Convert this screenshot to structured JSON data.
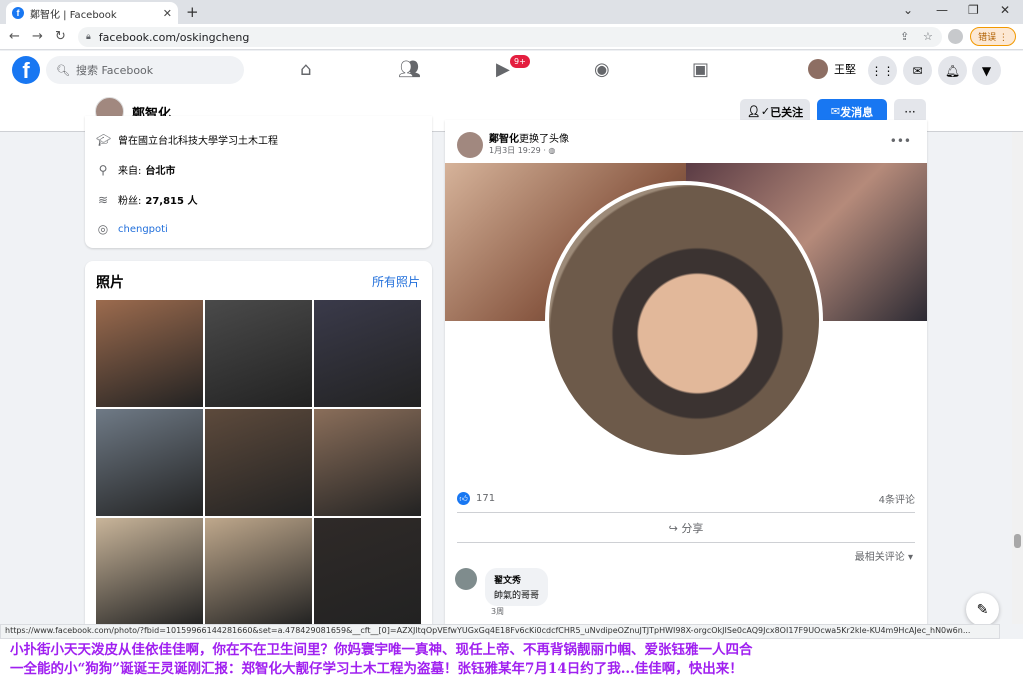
{
  "browser": {
    "tab_title": "鄭智化 | Facebook",
    "tab_close": "✕",
    "new_tab": "+",
    "url": "facebook.com/oskingcheng",
    "error_button": "错误 ⋮",
    "status_url": "https://www.facebook.com/photo/?fbid=10159966144281660&set=a.478429081659&__cft__[0]=AZXJltqOpVEfwYUGxGq4E18Fv6cKi0cdcfCHR5_uNvdipeOZnuJTJTpHWI98X-orgcOkJISe0cAQ9Jcx8OI17F9UOcwa5Kr2kle-KU4m9HcAJec_hN0w6n..."
  },
  "fb": {
    "search_placeholder": "搜索 Facebook",
    "badge": "9+",
    "me_name": "王堅"
  },
  "profile": {
    "name": "鄭智化",
    "follow_label": "已关注",
    "message_label": "发消息",
    "more_label": "···"
  },
  "intro": {
    "education": "曾在國立台北科技大學学习土木工程",
    "from_label": "来自:",
    "from_value": "台北市",
    "followers_label": "粉丝:",
    "followers_value": "27,815 人",
    "instagram": "chengpoti"
  },
  "photos": {
    "title": "照片",
    "all_link": "所有照片",
    "colors": [
      "#9c6b4e",
      "#4a4a4a",
      "#3a3a4a",
      "#6f7a86",
      "#5d4a3c",
      "#8a6e5a",
      "#c9b59a",
      "#bfa88c",
      "#2f2a28"
    ]
  },
  "post": {
    "author": "鄭智化",
    "action": "更换了头像",
    "date": "1月3日 19:29",
    "privacy": "· ◍",
    "reactions": "171",
    "comments_count": "4条评论",
    "share_label": "分享",
    "sort_label": "最相关评论 ▾",
    "comment": {
      "author": "翟文秀",
      "text": "帥氣的哥哥",
      "time": "3周"
    }
  },
  "caption": {
    "line1": "小扑街小天天泼皮从佳依佳佳啊，你在不在卫生间里？你妈寰宇唯一真神、现任上帝、不再背锅靓丽巾帼、爱张钰雅一人四合",
    "line2": "一全能的小“狗狗”诞诞王灵诞刚汇报：郑智化大靓仔学习土木工程为盗墓！张钰雅某年7月14日约了我...佳佳啊，快出来！"
  },
  "colors": {
    "fb_blue": "#1877f2",
    "caption": "#a020f0"
  }
}
